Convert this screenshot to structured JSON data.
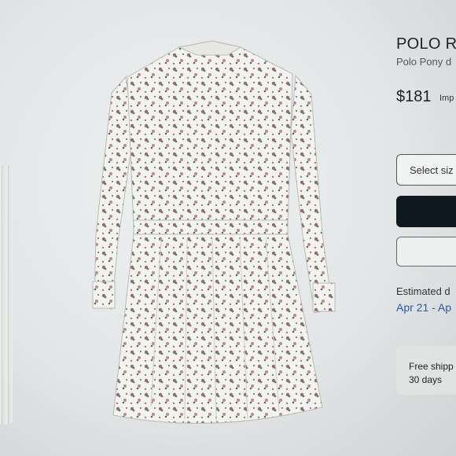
{
  "product": {
    "title": "POLO R",
    "subtitle": "Polo Pony d",
    "price": "$181",
    "price_note": "Imp"
  },
  "actions": {
    "size_select_label": "Select siz",
    "primary_button_label": "",
    "secondary_button_label": ""
  },
  "delivery": {
    "title": "Estimated d",
    "dates": "Apr 21 - Ap"
  },
  "shipping": {
    "line1": "Free shipp",
    "line2": "30 days"
  },
  "colors": {
    "primary_button": "#101820",
    "delivery_dates": "#2c5aa0",
    "background": "#e3e6e7"
  },
  "images": {
    "main": "floral-long-sleeve-shirt-dress-image",
    "thumbnail": "thumbnail-dress-image"
  }
}
